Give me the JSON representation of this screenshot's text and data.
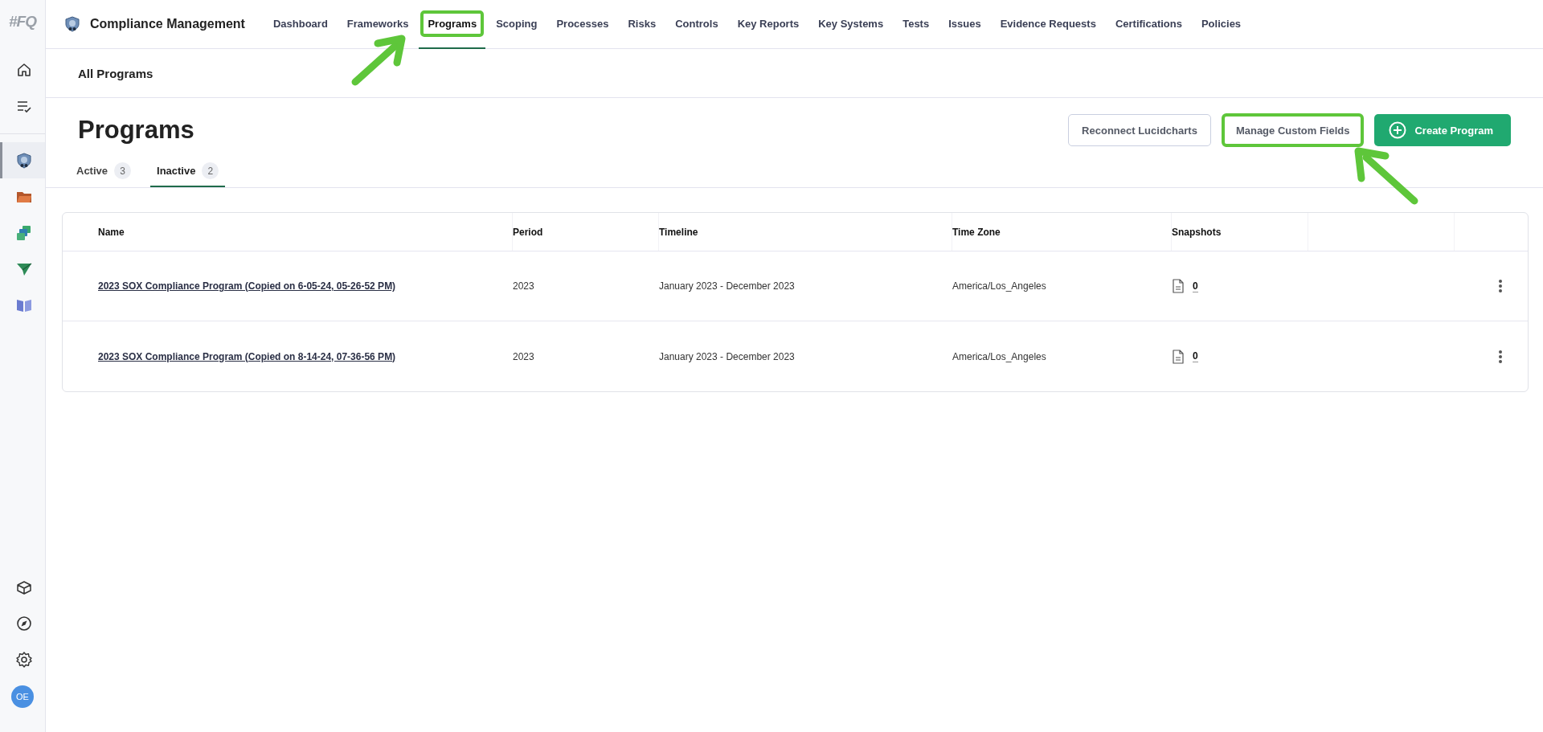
{
  "sidebar": {
    "logo": "#FQ",
    "top_items": [
      {
        "kind": "home",
        "selected": false
      },
      {
        "kind": "checklist",
        "selected": false
      }
    ],
    "app_items": [
      {
        "kind": "shield",
        "selected": true
      },
      {
        "kind": "folder",
        "selected": false
      },
      {
        "kind": "stack",
        "selected": false
      },
      {
        "kind": "plane",
        "selected": false
      },
      {
        "kind": "book",
        "selected": false
      }
    ],
    "bottom_items": [
      {
        "kind": "box",
        "selected": false
      },
      {
        "kind": "compass",
        "selected": false
      },
      {
        "kind": "gear",
        "selected": false
      }
    ],
    "avatar": "OE"
  },
  "app_title": "Compliance Management",
  "nav": [
    {
      "label": "Dashboard",
      "selected": false,
      "highlighted": false
    },
    {
      "label": "Frameworks",
      "selected": false,
      "highlighted": false
    },
    {
      "label": "Programs",
      "selected": true,
      "highlighted": true
    },
    {
      "label": "Scoping",
      "selected": false,
      "highlighted": false
    },
    {
      "label": "Processes",
      "selected": false,
      "highlighted": false
    },
    {
      "label": "Risks",
      "selected": false,
      "highlighted": false
    },
    {
      "label": "Controls",
      "selected": false,
      "highlighted": false
    },
    {
      "label": "Key Reports",
      "selected": false,
      "highlighted": false
    },
    {
      "label": "Key Systems",
      "selected": false,
      "highlighted": false
    },
    {
      "label": "Tests",
      "selected": false,
      "highlighted": false
    },
    {
      "label": "Issues",
      "selected": false,
      "highlighted": false
    },
    {
      "label": "Evidence Requests",
      "selected": false,
      "highlighted": false
    },
    {
      "label": "Certifications",
      "selected": false,
      "highlighted": false
    },
    {
      "label": "Policies",
      "selected": false,
      "highlighted": false
    }
  ],
  "breadcrumb": "All Programs",
  "page_title": "Programs",
  "buttons": [
    {
      "label": "Reconnect Lucidcharts",
      "kind": "secondary",
      "highlighted": false
    },
    {
      "label": "Manage Custom Fields",
      "kind": "secondary",
      "highlighted": true
    },
    {
      "label": "Create Program",
      "kind": "primary",
      "highlighted": false
    }
  ],
  "tabs": [
    {
      "label": "Active",
      "count": "3",
      "selected": false
    },
    {
      "label": "Inactive",
      "count": "2",
      "selected": true
    }
  ],
  "table": {
    "columns": [
      "Name",
      "Period",
      "Timeline",
      "Time Zone",
      "Snapshots"
    ],
    "rows": [
      {
        "name": "2023 SOX Compliance Program (Copied on 6-05-24, 05-26-52 PM)",
        "period": "2023",
        "timeline": "January 2023 - December 2023",
        "time_zone": "America/Los_Angeles",
        "snapshots": "0"
      },
      {
        "name": "2023 SOX Compliance Program (Copied on 8-14-24, 07-36-56 PM)",
        "period": "2023",
        "timeline": "January 2023 - December 2023",
        "time_zone": "America/Los_Angeles",
        "snapshots": "0"
      }
    ]
  }
}
